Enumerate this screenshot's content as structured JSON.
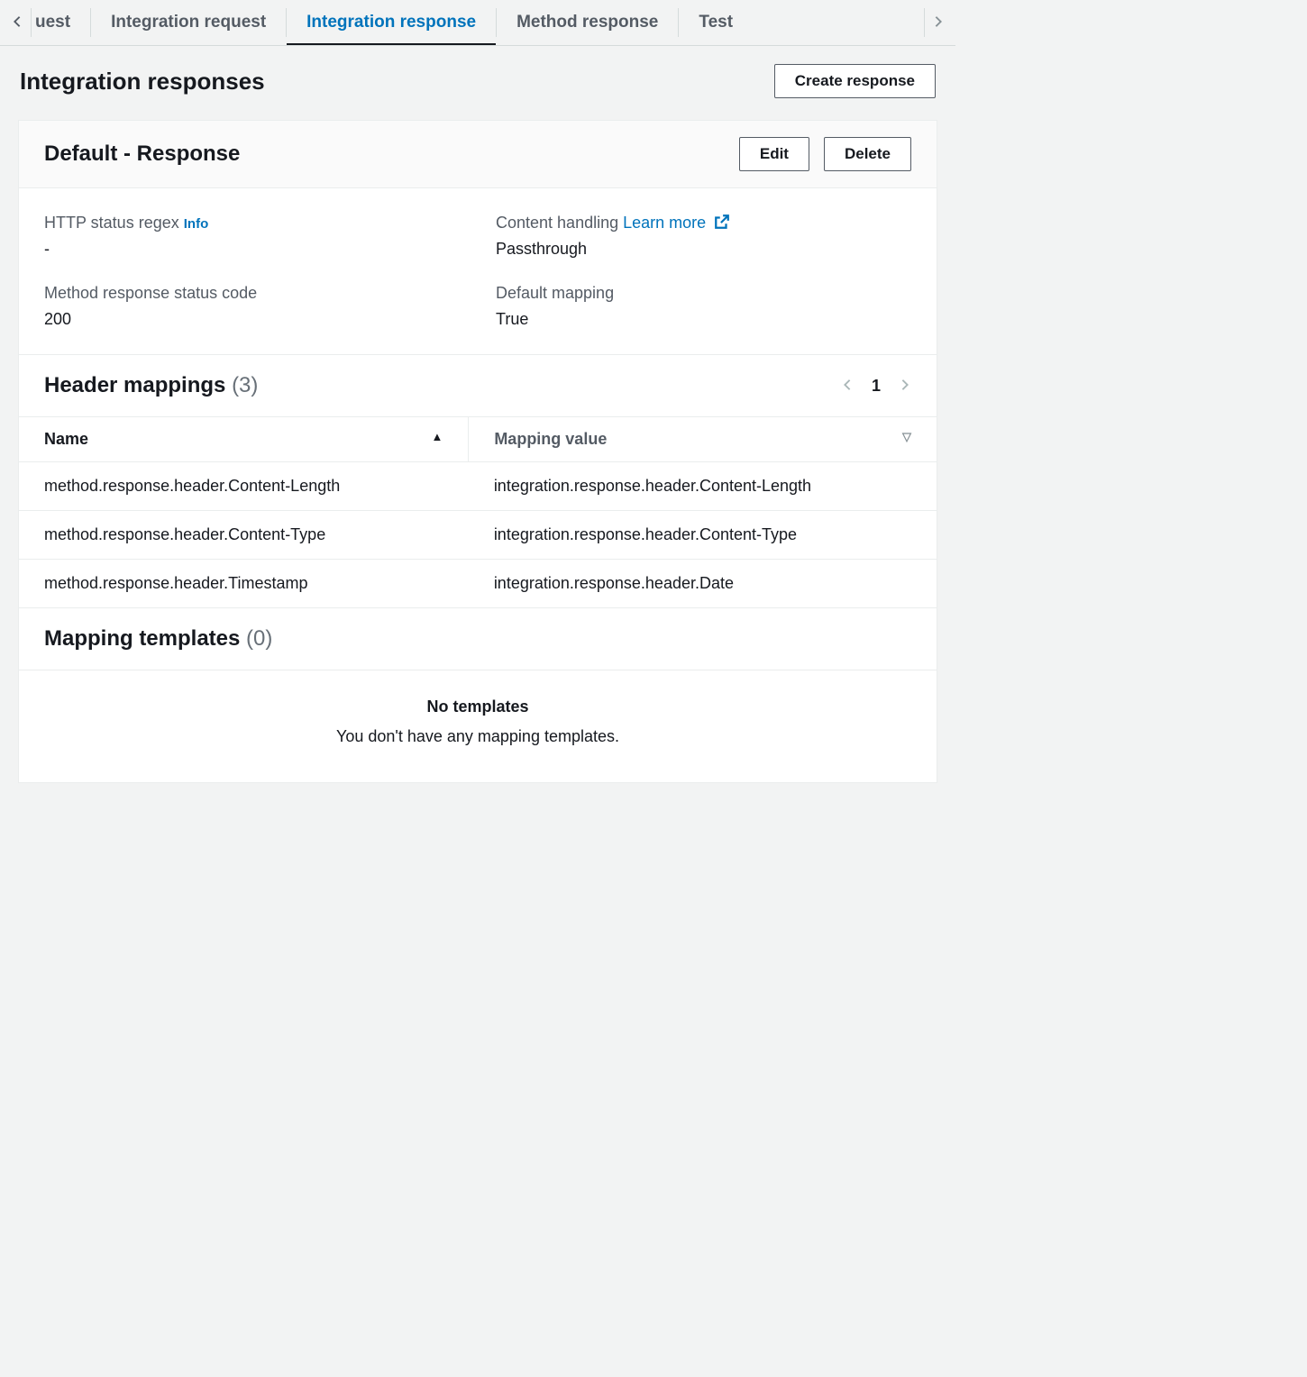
{
  "tabs": {
    "partial": "uest",
    "items": [
      "Integration request",
      "Integration response",
      "Method response",
      "Test"
    ],
    "activeIndex": 1
  },
  "page": {
    "title": "Integration responses",
    "create_button": "Create response"
  },
  "response": {
    "title": "Default - Response",
    "edit_button": "Edit",
    "delete_button": "Delete",
    "fields": {
      "http_regex_label": "HTTP status regex",
      "http_regex_info": "Info",
      "http_regex_value": "-",
      "content_handling_label": "Content handling",
      "content_handling_learn": "Learn more",
      "content_handling_value": "Passthrough",
      "method_status_label": "Method response status code",
      "method_status_value": "200",
      "default_mapping_label": "Default mapping",
      "default_mapping_value": "True"
    }
  },
  "header_mappings": {
    "title": "Header mappings",
    "count": "(3)",
    "page_num": "1",
    "col_name": "Name",
    "col_value": "Mapping value",
    "rows": [
      {
        "name": "method.response.header.Content-Length",
        "value": "integration.response.header.Content-Length"
      },
      {
        "name": "method.response.header.Content-Type",
        "value": "integration.response.header.Content-Type"
      },
      {
        "name": "method.response.header.Timestamp",
        "value": "integration.response.header.Date"
      }
    ]
  },
  "mapping_templates": {
    "title": "Mapping templates",
    "count": "(0)",
    "empty_title": "No templates",
    "empty_sub": "You don't have any mapping templates."
  }
}
